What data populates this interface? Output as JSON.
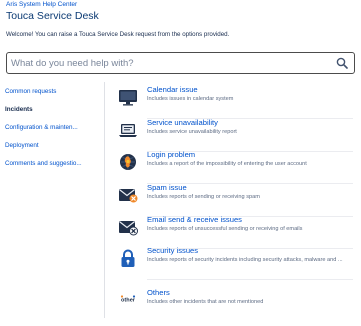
{
  "header": {
    "help_center": "Aris System Help Center",
    "title": "Touca Service Desk",
    "welcome": "Welcome! You can raise a Touca Service Desk request from the options provided."
  },
  "search": {
    "placeholder": "What do you need help with?",
    "icon": "search-icon"
  },
  "sidebar": {
    "items": [
      {
        "label": "Common requests",
        "active": false
      },
      {
        "label": "Incidents",
        "active": true
      },
      {
        "label": "Configuration & mainten...",
        "active": false
      },
      {
        "label": "Deployment",
        "active": false
      },
      {
        "label": "Comments and suggestio...",
        "active": false
      }
    ]
  },
  "requests": [
    {
      "title": "Calendar issue",
      "description": "Includes issues in calendar system",
      "icon": "monitor-icon"
    },
    {
      "title": "Service unavailability",
      "description": "Includes service unavailability report",
      "icon": "laptop-icon"
    },
    {
      "title": "Login problem",
      "description": "Includes a report of the impossibility of entering the user account",
      "icon": "login-globe-icon"
    },
    {
      "title": "Spam issue",
      "description": "Includes reports of sending or receiving spam",
      "icon": "spam-mail-icon"
    },
    {
      "title": "Email send & receive issues",
      "description": "Includes reports of unsuccessful sending or receiving of emails",
      "icon": "mail-error-icon"
    },
    {
      "title": "Security issues",
      "description": "Includes reports of security incidents including security attacks, malware and ...",
      "icon": "lock-icon"
    },
    {
      "title": "Others",
      "description": "Includes other incidents that are not mentioned",
      "icon": "others-icon"
    }
  ],
  "colors": {
    "link": "#0052cc",
    "title": "#0b3a73",
    "icon_dark": "#22314a",
    "icon_orange": "#f0892a",
    "icon_blue": "#1f5fb8"
  }
}
